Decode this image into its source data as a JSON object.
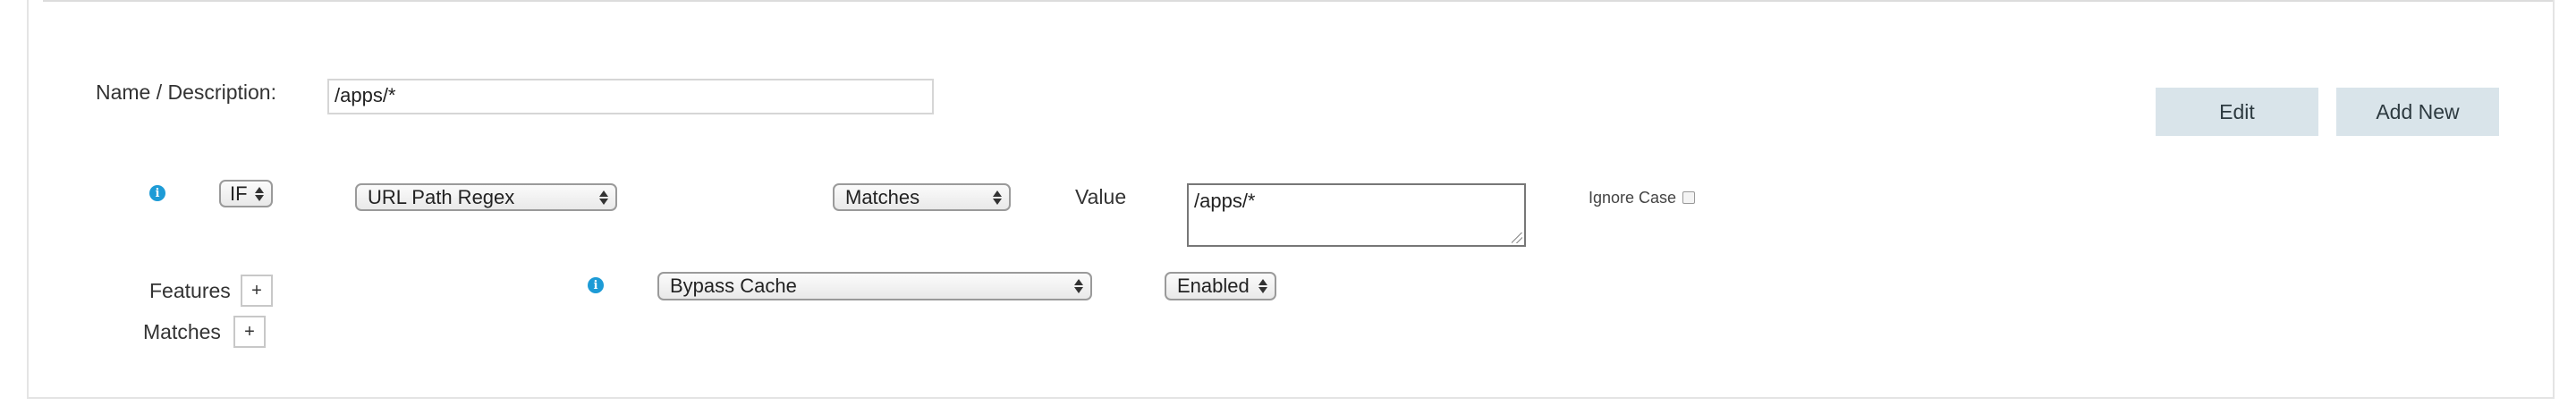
{
  "form": {
    "name_label": "Name / Description:",
    "name_value": "/apps/*",
    "edit_button": "Edit",
    "add_new_button": "Add New"
  },
  "condition": {
    "if_select": "IF",
    "match_type_select": "URL Path Regex",
    "operator_select": "Matches",
    "value_label": "Value",
    "value_text": "/apps/*",
    "ignore_case_label": "Ignore Case",
    "ignore_case_checked": false
  },
  "features": {
    "features_label": "Features",
    "matches_label": "Matches",
    "plus_glyph": "+",
    "feature_select": "Bypass Cache",
    "state_select": "Enabled"
  },
  "icons": {
    "info_glyph": "i",
    "info_color": "#1d9bd6"
  },
  "colors": {
    "button_bg": "#d9e4ea",
    "border": "#e4e4e4"
  }
}
